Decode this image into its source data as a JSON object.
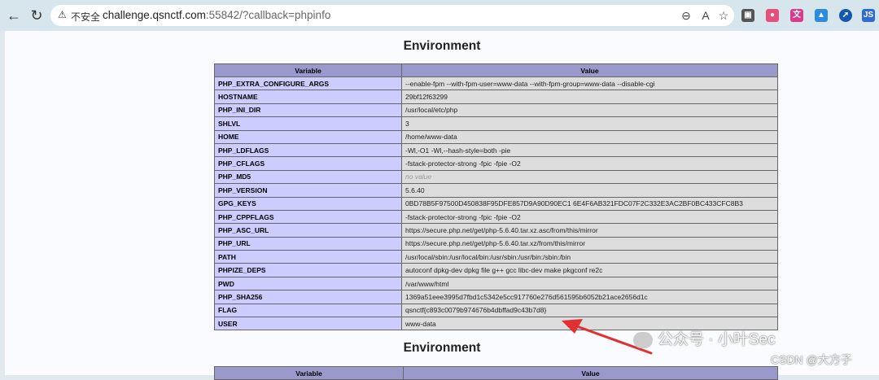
{
  "browser": {
    "insecure_label": "不安全",
    "host": "challenge.qsnctf.com",
    "path": ":55842/?callback=phpinfo"
  },
  "page": {
    "section_title": "Environment",
    "columns": [
      "Variable",
      "Value"
    ],
    "rows": [
      {
        "k": "PHP_EXTRA_CONFIGURE_ARGS",
        "v": "--enable-fpm --with-fpm-user=www-data --with-fpm-group=www-data --disable-cgi"
      },
      {
        "k": "HOSTNAME",
        "v": "29bf12f63299"
      },
      {
        "k": "PHP_INI_DIR",
        "v": "/usr/local/etc/php"
      },
      {
        "k": "SHLVL",
        "v": "3"
      },
      {
        "k": "HOME",
        "v": "/home/www-data"
      },
      {
        "k": "PHP_LDFLAGS",
        "v": "-Wl,-O1 -Wl,--hash-style=both -pie"
      },
      {
        "k": "PHP_CFLAGS",
        "v": "-fstack-protector-strong -fpic -fpie -O2"
      },
      {
        "k": "PHP_MD5",
        "v": "no value"
      },
      {
        "k": "PHP_VERSION",
        "v": "5.6.40"
      },
      {
        "k": "GPG_KEYS",
        "v": "0BD78B5F97500D450838F95DFE857D9A90D90EC1 6E4F6AB321FDC07F2C332E3AC2BF0BC433CFC8B3"
      },
      {
        "k": "PHP_CPPFLAGS",
        "v": "-fstack-protector-strong -fpic -fpie -O2"
      },
      {
        "k": "PHP_ASC_URL",
        "v": "https://secure.php.net/get/php-5.6.40.tar.xz.asc/from/this/mirror"
      },
      {
        "k": "PHP_URL",
        "v": "https://secure.php.net/get/php-5.6.40.tar.xz/from/this/mirror"
      },
      {
        "k": "PATH",
        "v": "/usr/local/sbin:/usr/local/bin:/usr/sbin:/usr/bin:/sbin:/bin"
      },
      {
        "k": "PHPIZE_DEPS",
        "v": "autoconf dpkg-dev dpkg file g++ gcc libc-dev make pkgconf re2c"
      },
      {
        "k": "PWD",
        "v": "/var/www/html"
      },
      {
        "k": "PHP_SHA256",
        "v": "1369a51eee3995d7fbd1c5342e5cc917760e276d561595b6052b21ace2656d1c"
      },
      {
        "k": "FLAG",
        "v": "qsnctf{c893c0079b974676b4dbffad9c43b7d8}"
      },
      {
        "k": "USER",
        "v": "www-data"
      }
    ]
  },
  "watermark": {
    "wechat": "公众号 · 小叶Sec",
    "csdn": "CSDN @大方子"
  },
  "colors": {
    "header": "#9999cc",
    "key_cell": "#ccccff",
    "value_cell": "#dddddd",
    "arrow": "#e03030"
  }
}
